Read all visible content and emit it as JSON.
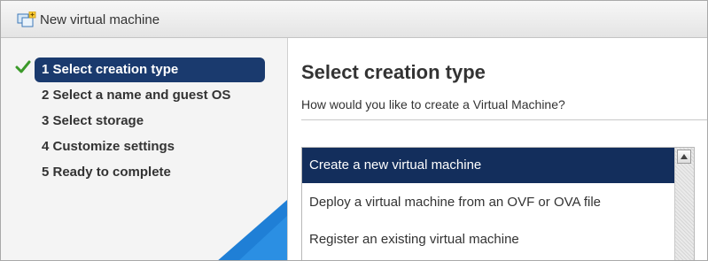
{
  "window": {
    "title": "New virtual machine",
    "icon": "new-vm-icon"
  },
  "wizard": {
    "steps": [
      {
        "label": "1 Select creation type",
        "active": true,
        "completed": true
      },
      {
        "label": "2 Select a name and guest OS",
        "active": false,
        "completed": false
      },
      {
        "label": "3 Select storage",
        "active": false,
        "completed": false
      },
      {
        "label": "4 Customize settings",
        "active": false,
        "completed": false
      },
      {
        "label": "5 Ready to complete",
        "active": false,
        "completed": false
      }
    ],
    "completed_icon": "check-icon"
  },
  "main": {
    "title": "Select creation type",
    "subtitle": "How would you like to create a Virtual Machine?",
    "options": [
      {
        "label": "Create a new virtual machine",
        "selected": true
      },
      {
        "label": "Deploy a virtual machine from an OVF or OVA file",
        "selected": false
      },
      {
        "label": "Register an existing virtual machine",
        "selected": false
      }
    ]
  },
  "colors": {
    "active_step_bg": "#1a3a6e",
    "selected_option_bg": "#132e5c",
    "check": "#3c9a2a",
    "accent_blue": "#1f7fd6"
  }
}
